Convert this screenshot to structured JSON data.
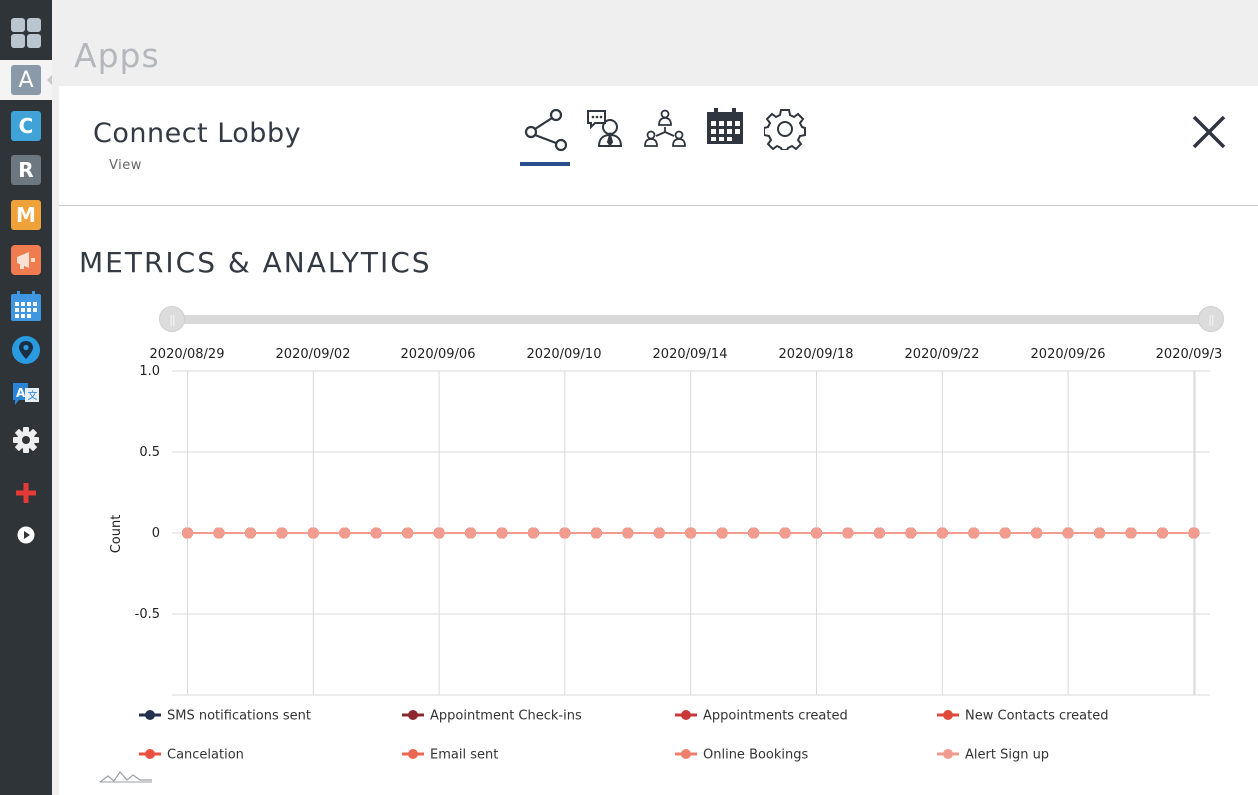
{
  "page": {
    "title": "Apps"
  },
  "rail": {
    "items": [
      {
        "name": "dashboard-icon",
        "letter": ""
      },
      {
        "name": "app-a-icon",
        "letter": "A",
        "color": "#8a9aa8"
      },
      {
        "name": "app-c-icon",
        "letter": "C",
        "color": "#3fa3d8"
      },
      {
        "name": "app-r-icon",
        "letter": "R",
        "color": "#6d7780"
      },
      {
        "name": "app-m-icon",
        "letter": "M",
        "color": "#f0a23a"
      },
      {
        "name": "megaphone-icon",
        "letter": "",
        "color": "#ef7b4e"
      },
      {
        "name": "calendar-icon",
        "letter": "",
        "color": "#3e97e0"
      },
      {
        "name": "map-pin-icon",
        "letter": "",
        "color": "#2a9be0"
      },
      {
        "name": "translate-icon",
        "letter": "",
        "color": "#2a85d6"
      },
      {
        "name": "gear-icon",
        "letter": ""
      },
      {
        "name": "plus-icon",
        "letter": "",
        "color": "#e53935"
      },
      {
        "name": "play-icon",
        "letter": ""
      }
    ]
  },
  "panel": {
    "title": "Connect Lobby",
    "subtitle": "View",
    "tabs": [
      {
        "name": "tab-share",
        "icon": "share-icon",
        "active": true
      },
      {
        "name": "tab-chat-agent",
        "icon": "chat-agent-icon",
        "active": false
      },
      {
        "name": "tab-network",
        "icon": "network-users-icon",
        "active": false
      },
      {
        "name": "tab-calendar",
        "icon": "calendar-icon",
        "active": false
      },
      {
        "name": "tab-settings",
        "icon": "gear-icon",
        "active": false
      }
    ],
    "section_title": "METRICS & ANALYTICS"
  },
  "chart_data": {
    "type": "line",
    "x_tick_labels": [
      "2020/08/29",
      "2020/09/02",
      "2020/09/06",
      "2020/09/10",
      "2020/09/14",
      "2020/09/18",
      "2020/09/22",
      "2020/09/26",
      "2020/09/3"
    ],
    "x": [
      "2020/08/29",
      "2020/08/30",
      "2020/08/31",
      "2020/09/01",
      "2020/09/02",
      "2020/09/03",
      "2020/09/04",
      "2020/09/05",
      "2020/09/06",
      "2020/09/07",
      "2020/09/08",
      "2020/09/09",
      "2020/09/10",
      "2020/09/11",
      "2020/09/12",
      "2020/09/13",
      "2020/09/14",
      "2020/09/15",
      "2020/09/16",
      "2020/09/17",
      "2020/09/18",
      "2020/09/19",
      "2020/09/20",
      "2020/09/21",
      "2020/09/22",
      "2020/09/23",
      "2020/09/24",
      "2020/09/25",
      "2020/09/26",
      "2020/09/27",
      "2020/09/28",
      "2020/09/29",
      "2020/09/30"
    ],
    "y_ticks": [
      "1.0",
      "0.5",
      "0",
      "-0.5"
    ],
    "ylim": [
      -1.0,
      1.0
    ],
    "ylabel": "Count",
    "grid": true,
    "legend_position": "bottom",
    "series": [
      {
        "name": "SMS notifications sent",
        "color": "#24304f",
        "values": [
          0,
          0,
          0,
          0,
          0,
          0,
          0,
          0,
          0,
          0,
          0,
          0,
          0,
          0,
          0,
          0,
          0,
          0,
          0,
          0,
          0,
          0,
          0,
          0,
          0,
          0,
          0,
          0,
          0,
          0,
          0,
          0,
          0
        ]
      },
      {
        "name": "Appointment Check-ins",
        "color": "#8a2a2e",
        "values": [
          0,
          0,
          0,
          0,
          0,
          0,
          0,
          0,
          0,
          0,
          0,
          0,
          0,
          0,
          0,
          0,
          0,
          0,
          0,
          0,
          0,
          0,
          0,
          0,
          0,
          0,
          0,
          0,
          0,
          0,
          0,
          0,
          0
        ]
      },
      {
        "name": "Appointments created",
        "color": "#c9383a",
        "values": [
          0,
          0,
          0,
          0,
          0,
          0,
          0,
          0,
          0,
          0,
          0,
          0,
          0,
          0,
          0,
          0,
          0,
          0,
          0,
          0,
          0,
          0,
          0,
          0,
          0,
          0,
          0,
          0,
          0,
          0,
          0,
          0,
          0
        ]
      },
      {
        "name": "New Contacts created",
        "color": "#e04a3a",
        "values": [
          0,
          0,
          0,
          0,
          0,
          0,
          0,
          0,
          0,
          0,
          0,
          0,
          0,
          0,
          0,
          0,
          0,
          0,
          0,
          0,
          0,
          0,
          0,
          0,
          0,
          0,
          0,
          0,
          0,
          0,
          0,
          0,
          0
        ]
      },
      {
        "name": "Cancelation",
        "color": "#e9503f",
        "values": [
          0,
          0,
          0,
          0,
          0,
          0,
          0,
          0,
          0,
          0,
          0,
          0,
          0,
          0,
          0,
          0,
          0,
          0,
          0,
          0,
          0,
          0,
          0,
          0,
          0,
          0,
          0,
          0,
          0,
          0,
          0,
          0,
          0
        ]
      },
      {
        "name": "Email sent",
        "color": "#ec6752",
        "values": [
          0,
          0,
          0,
          0,
          0,
          0,
          0,
          0,
          0,
          0,
          0,
          0,
          0,
          0,
          0,
          0,
          0,
          0,
          0,
          0,
          0,
          0,
          0,
          0,
          0,
          0,
          0,
          0,
          0,
          0,
          0,
          0,
          0
        ]
      },
      {
        "name": "Online Bookings",
        "color": "#f07e6c",
        "values": [
          0,
          0,
          0,
          0,
          0,
          0,
          0,
          0,
          0,
          0,
          0,
          0,
          0,
          0,
          0,
          0,
          0,
          0,
          0,
          0,
          0,
          0,
          0,
          0,
          0,
          0,
          0,
          0,
          0,
          0,
          0,
          0,
          0
        ]
      },
      {
        "name": "Alert Sign up",
        "color": "#f19c8f",
        "values": [
          0,
          0,
          0,
          0,
          0,
          0,
          0,
          0,
          0,
          0,
          0,
          0,
          0,
          0,
          0,
          0,
          0,
          0,
          0,
          0,
          0,
          0,
          0,
          0,
          0,
          0,
          0,
          0,
          0,
          0,
          0,
          0,
          0
        ]
      }
    ]
  }
}
